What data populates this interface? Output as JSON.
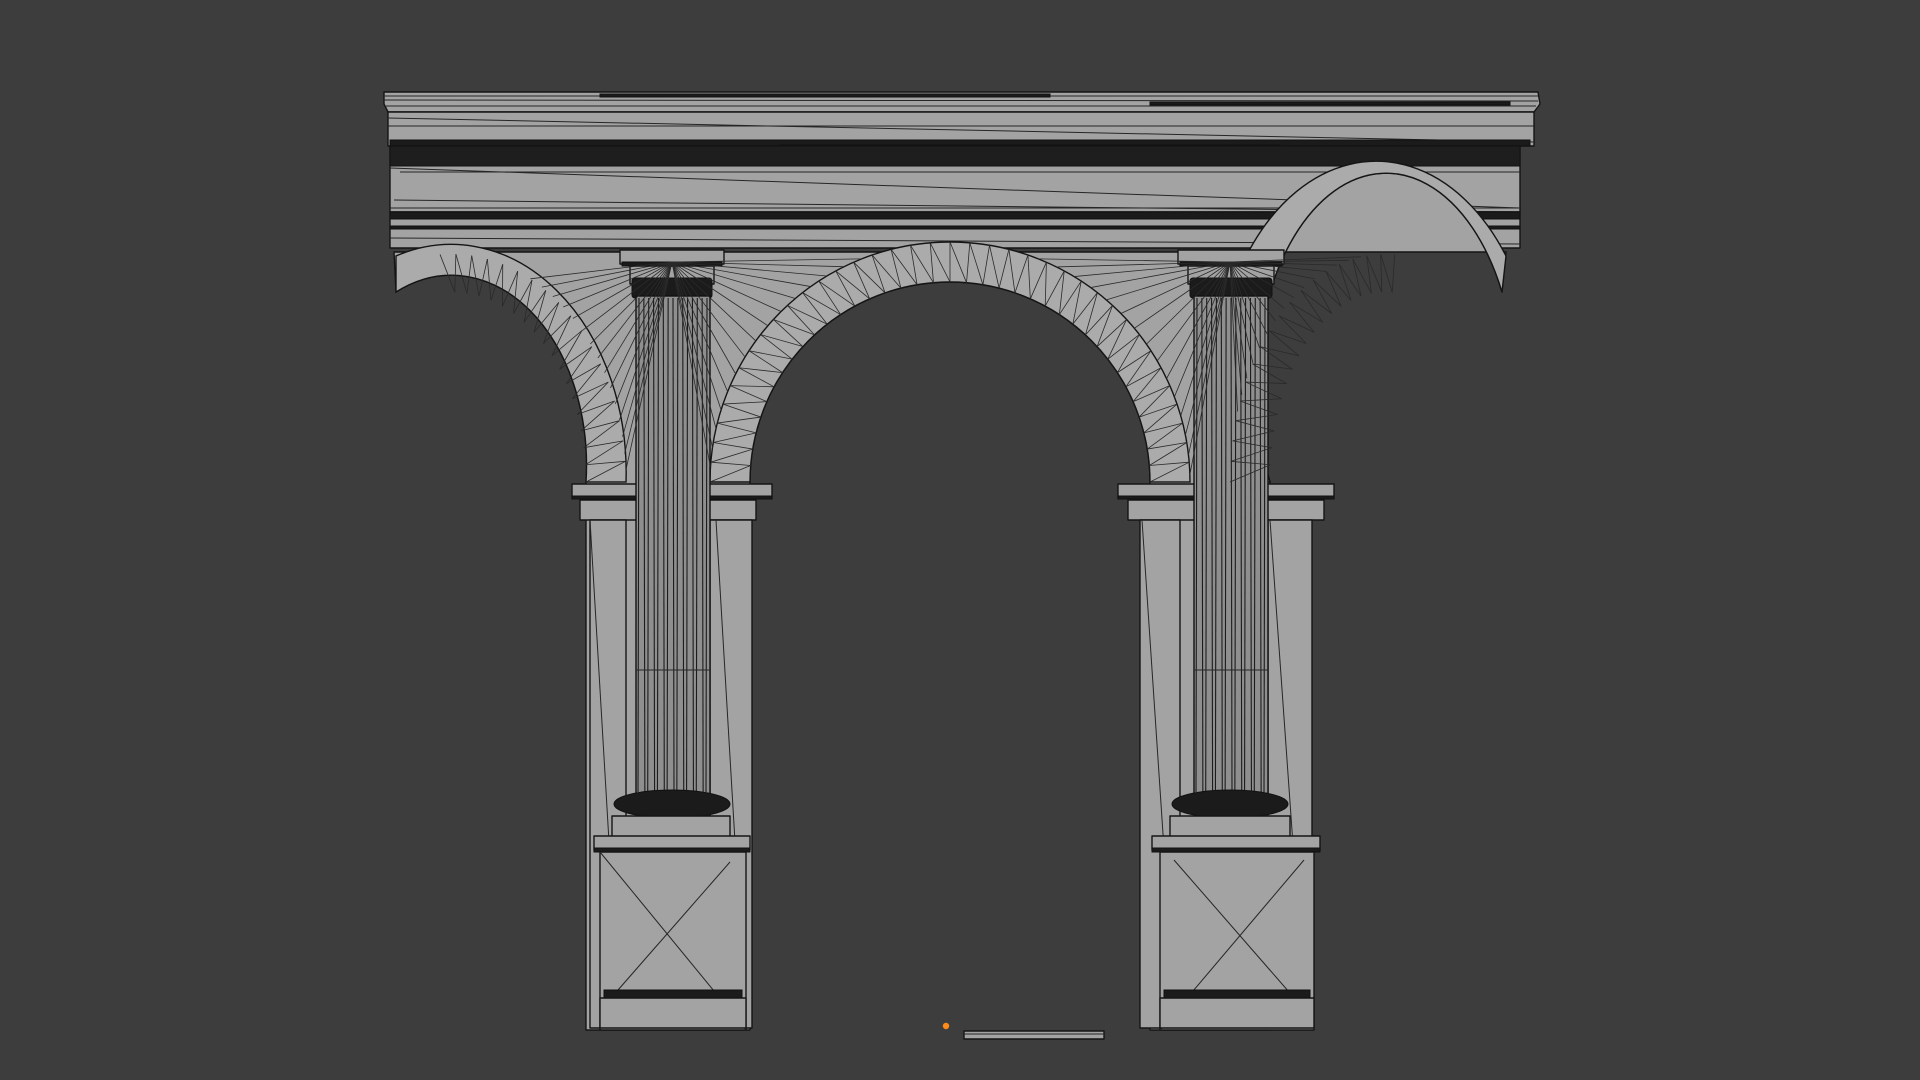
{
  "viewport": {
    "background": "#3d3d3d",
    "model_fill": "#a3a3a3",
    "wire_color": "#1a1a1a",
    "origin_marker_color": "#ff8c1a"
  },
  "model": {
    "type": "wireframe-arcade",
    "arch_count": 3,
    "column_count": 2,
    "column_order": "tuscan"
  },
  "icons": {
    "origin": "origin-dot-icon"
  }
}
